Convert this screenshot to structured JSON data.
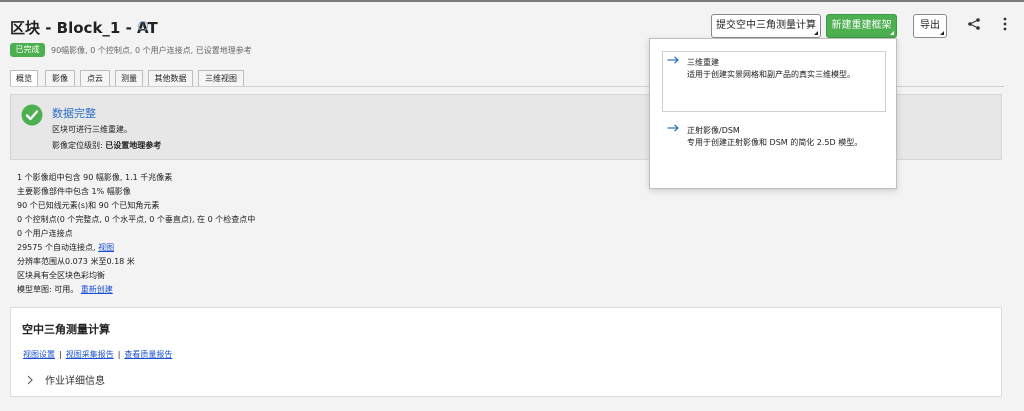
{
  "header": {
    "title": "区块 - Block_1 - AT",
    "buttons": {
      "submit_at": "提交空中三角测量计算",
      "new_recon": "新建重建框架",
      "export": "导出"
    }
  },
  "status": {
    "badge": "已完成",
    "summary": "90幅影像, 0 个控制点, 0 个用户连接点, 已设置地理参考"
  },
  "tabs": [
    "概览",
    "影像",
    "点云",
    "测量",
    "其他数据",
    "三维视图"
  ],
  "panel": {
    "title": "数据完整",
    "line1": "区块可进行三维重建。",
    "line2_label": "影像定位级别: ",
    "line2_value": "已设置地理参考"
  },
  "stats": {
    "line1": "1 个影像组中包含 90 幅影像, 1.1 千兆像素",
    "line2": "主要影像部件中包含 1% 幅影像",
    "line3": "90 个已知线元素(s)和 90 个已知角元素",
    "line4": "0 个控制点(0 个完整点, 0 个水平点, 0 个垂直点), 在 0 个检查点中",
    "line5": "0 个用户连接点",
    "line6_text": "29575 个自动连接点, ",
    "line6_link": "视图",
    "line7": "分辨率范围从0.073 米至0.18 米",
    "line8": "区块具有全区块色彩均衡",
    "line9_text": "模型草图: 可用。 ",
    "line9_link": "重新创建"
  },
  "at_card": {
    "title": "空中三角测量计算",
    "links": [
      "视图设置",
      "视图采集报告",
      "查看质量报告"
    ],
    "separator": "|",
    "details": "作业详细信息"
  },
  "dropdown": {
    "items": [
      {
        "title": "三维重建",
        "desc": "适用于创建实景网格和副产品的真实三维模型。"
      },
      {
        "title": "正射影像/DSM",
        "desc": "专用于创建正射影像和 DSM 的简化 2.5D 模型。"
      }
    ]
  },
  "colors": {
    "accent_green": "#4caf50",
    "link_blue": "#1a4fd1",
    "title_blue": "#2b6fc2"
  },
  "icons": [
    "info-icon",
    "share-icon",
    "more-vertical-icon",
    "check-circle-icon",
    "chevron-right-icon",
    "arrow-right-icon"
  ]
}
